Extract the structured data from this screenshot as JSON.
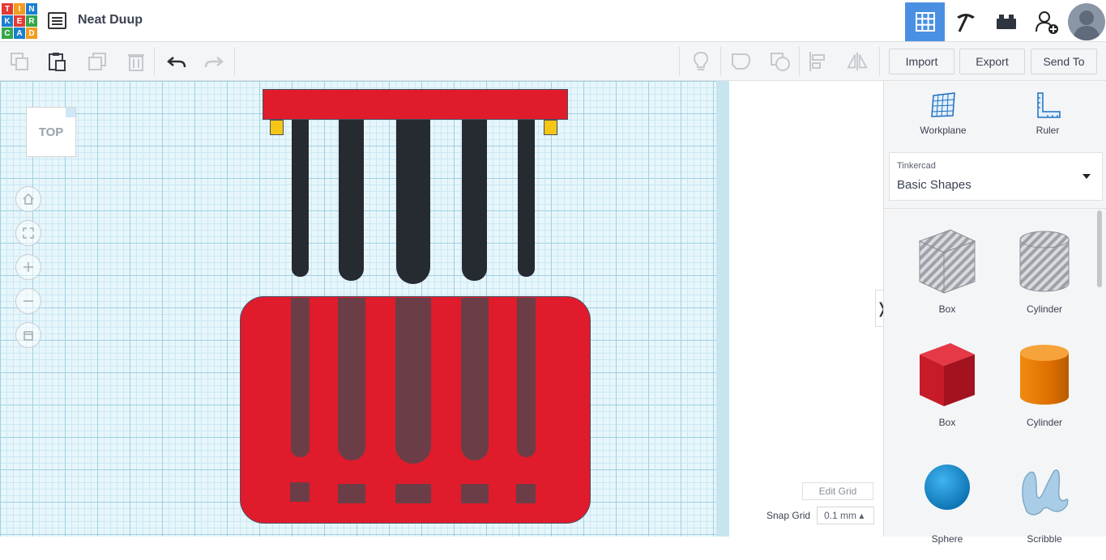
{
  "header": {
    "logo_letters": [
      "T",
      "I",
      "N",
      "K",
      "E",
      "R",
      "C",
      "A",
      "D"
    ],
    "logo_colors": [
      "#e33a34",
      "#f39c1e",
      "#1a7fcf",
      "#1a7fcf",
      "#e33a34",
      "#35a74b",
      "#35a74b",
      "#1a7fcf",
      "#f39c1e"
    ],
    "project_title": "Neat Duup",
    "nav": [
      {
        "name": "3d-design-grid-icon",
        "active": true
      },
      {
        "name": "codeblocks-pickaxe-icon",
        "active": false
      },
      {
        "name": "bricks-icon",
        "active": false
      },
      {
        "name": "add-user-icon",
        "active": false
      }
    ]
  },
  "toolbar": {
    "icons": [
      "copy-icon",
      "paste-icon",
      "duplicate-icon",
      "delete-icon",
      "undo-icon",
      "redo-icon",
      "light-bulb-icon",
      "group-icon",
      "ungroup-icon",
      "align-icon",
      "mirror-icon"
    ],
    "import_label": "Import",
    "export_label": "Export",
    "sendto_label": "Send To"
  },
  "viewport": {
    "viewcube_label": "TOP",
    "nav_controls": [
      "home-view-icon",
      "fit-view-icon",
      "zoom-in-icon",
      "zoom-out-icon",
      "perspective-icon"
    ],
    "edit_grid_label": "Edit Grid",
    "snap_grid_label": "Snap Grid",
    "snap_grid_value": "0.1 mm ▴",
    "colors": {
      "workplane": "#e7f6fb",
      "red": "#e01b2c",
      "dark": "#262a31",
      "yellow": "#f5c518",
      "ghost": "#6b3e47"
    }
  },
  "panel": {
    "workplane_label": "Workplane",
    "ruler_label": "Ruler",
    "library_source": "Tinkercad",
    "library_name": "Basic Shapes",
    "shapes": [
      {
        "label": "Box",
        "icon": "box-hole-icon"
      },
      {
        "label": "Cylinder",
        "icon": "cylinder-hole-icon"
      },
      {
        "label": "Box",
        "icon": "box-solid-icon"
      },
      {
        "label": "Cylinder",
        "icon": "cylinder-solid-icon"
      },
      {
        "label": "Sphere",
        "icon": "sphere-icon"
      },
      {
        "label": "Scribble",
        "icon": "scribble-icon"
      }
    ]
  }
}
